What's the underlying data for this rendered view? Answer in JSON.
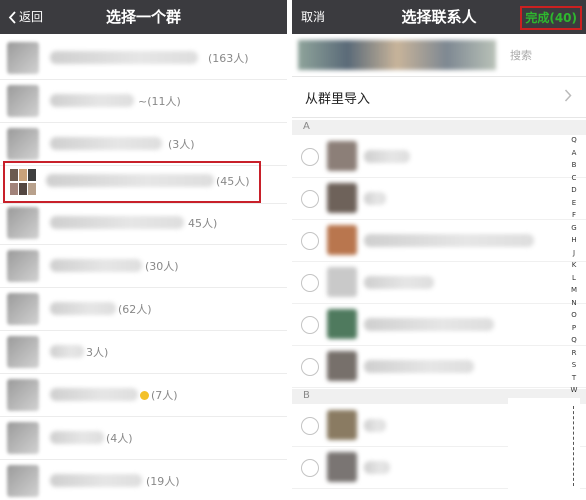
{
  "left_screen": {
    "back_label": "返回",
    "title": "选择一个群",
    "groups": [
      {
        "count": "(163人)"
      },
      {
        "count": "~(11人)"
      },
      {
        "count": "(3人)"
      },
      {
        "count": "(45人)"
      },
      {
        "count": "45人)"
      },
      {
        "count": "(30人)"
      },
      {
        "count": "(62人)"
      },
      {
        "count": "3人)"
      },
      {
        "count": "(7人)"
      },
      {
        "count": "(4人)"
      },
      {
        "count": "(19人)"
      }
    ]
  },
  "right_screen": {
    "cancel_label": "取消",
    "title": "选择联系人",
    "done_label": "完成(40)",
    "search_placeholder": "搜索",
    "import_label": "从群里导入",
    "section_a": "A",
    "section_b": "B",
    "index_letters": [
      "Q",
      "A",
      "B",
      "C",
      "D",
      "E",
      "F",
      "G",
      "H",
      "J",
      "K",
      "L",
      "M",
      "N",
      "O",
      "P",
      "Q",
      "R",
      "S",
      "T",
      "W",
      "X",
      "Y"
    ]
  },
  "colors": {
    "navbar": "#3b3b3f",
    "highlight_border": "#c8202a",
    "done_text": "#2eb82e"
  }
}
